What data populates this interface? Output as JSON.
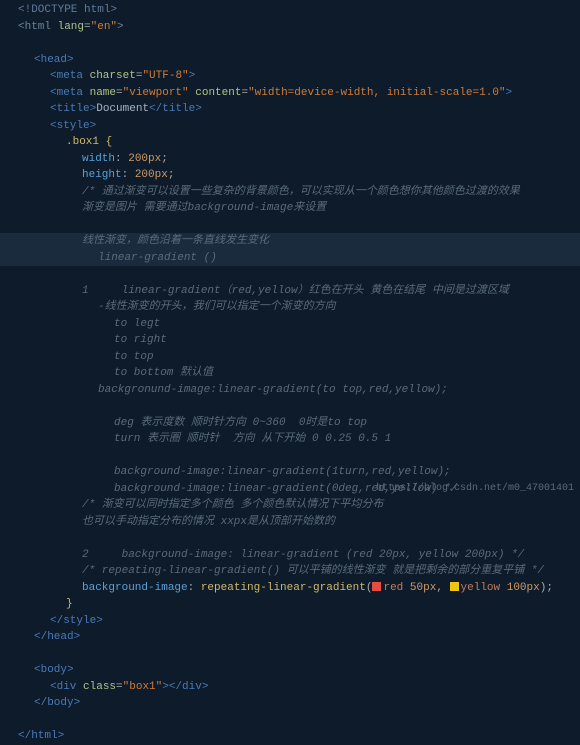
{
  "lines": {
    "l0": "<!DOCTYPE html>",
    "l1_open": "<html ",
    "l1_attr": "lang",
    "l1_eq": "=",
    "l1_val": "\"en\"",
    "l1_close": ">",
    "l_head_open": "<head>",
    "l_meta1_open": "<meta ",
    "l_meta1_attr": "charset",
    "l_meta1_val": "\"UTF-8\"",
    "l_meta1_close": ">",
    "l_meta2_open": "<meta ",
    "l_meta2_a1": "name",
    "l_meta2_v1": "\"viewport\"",
    "l_meta2_a2": "content",
    "l_meta2_v2": "\"width=device-width, initial-scale=1.0\"",
    "l_meta2_close": ">",
    "l_title_open": "<title>",
    "l_title_text": "Document",
    "l_title_close": "</title>",
    "l_style_open": "<style>",
    "l_sel": ".box1 ",
    "l_brace_open": "{",
    "l_p_width": "width",
    "l_v_width": " 200px",
    "l_p_height": "height",
    "l_v_height": " 200px",
    "l_c1": "/* 通过渐变可以设置一些复杂的背景颜色，可以实现从一个颜色想你其他颜色过渡的效果",
    "l_c2": "渐变是图片 需要通过background-image来设置",
    "l_c3": "线性渐变，颜色沿着一条直线发生变化",
    "l_c4": "linear-gradient ()",
    "l_c5": "1     linear-gradient（red,yellow）红色在开头 黄色在结尾 中间是过渡区域",
    "l_c6": "-线性渐变的开头，我们可以指定一个渐变的方向",
    "l_c7": "to legt",
    "l_c8": "to right",
    "l_c9": "to top",
    "l_c10": "to bottom 默认值",
    "l_c11": "backgronund-image:linear-gradient(to top,red,yellow);",
    "l_c12": "deg 表示度数 顺时针方向 0~360  0时是to top",
    "l_c13": "turn 表示圈 顺时针  方向 从下开始 0 0.25 0.5 1",
    "l_c14": "background-image:linear-gradient(1turn,red,yellow);",
    "l_c15": "background-image:linear-gradient(0deg,red,yellow) */",
    "l_c16": "/* 渐变可以同时指定多个颜色 多个颜色默认情况下平均分布",
    "l_c17": "也可以手动指定分布的情况 xxpx是从顶部开始数的",
    "l_c18": "2     background-image: linear-gradient (red 20px, yellow 200px) */",
    "l_c19": "/* repeating-linear-gradient() 可以平铺的线性渐变 就是把剩余的部分重复平铺 */",
    "l_p_bgimg": "background-image",
    "l_v_func": " repeating-linear-gradient",
    "l_v_red": "red",
    "l_v_50": " 50px",
    "l_v_yellow": "yellow",
    "l_v_100": " 100px",
    "l_brace_close": "}",
    "l_style_close": "</style>",
    "l_head_close": "</head>",
    "l_body_open": "<body>",
    "l_div_open": "<div ",
    "l_div_attr": "class",
    "l_div_val": "\"box1\"",
    "l_div_mid": ">",
    "l_div_close": "</div>",
    "l_body_close": "</body>",
    "l_html_close": "</html>"
  },
  "watermark": "https://blog.csdn.net/m0_47001401"
}
